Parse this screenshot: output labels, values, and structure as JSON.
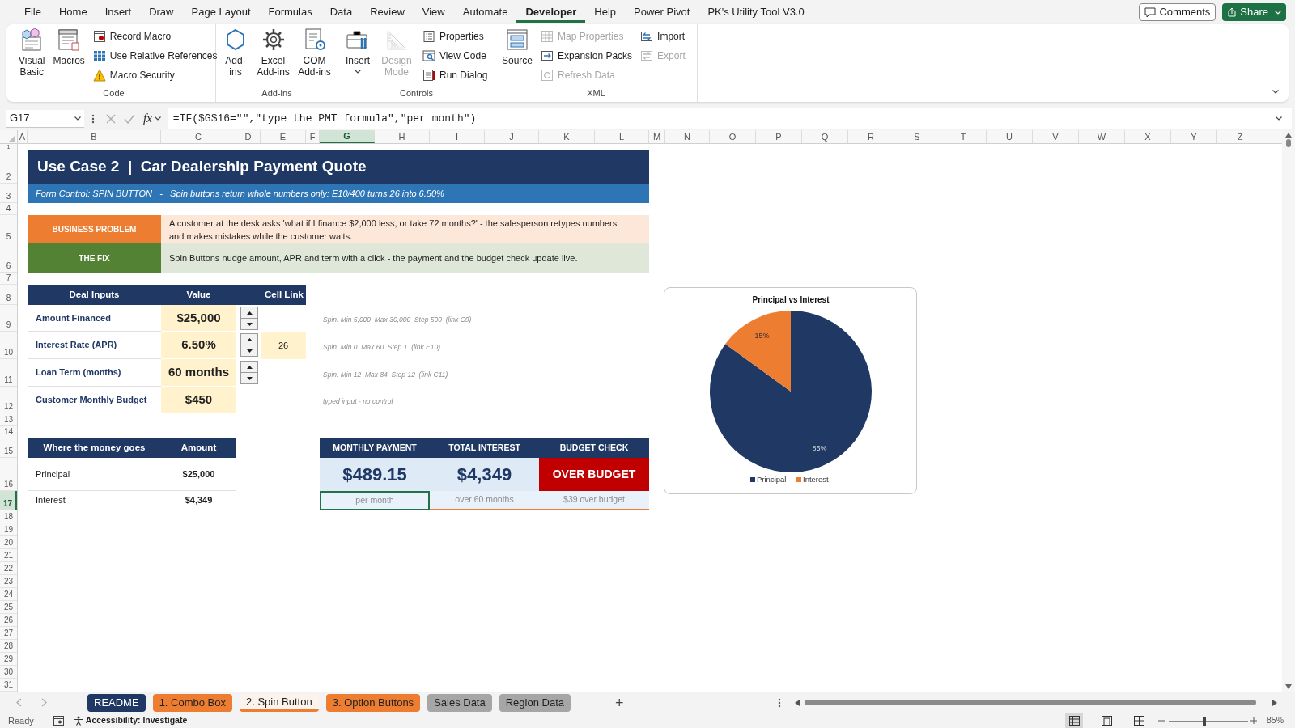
{
  "menu_tabs": [
    {
      "label": "File",
      "selected": false
    },
    {
      "label": "Home",
      "selected": false
    },
    {
      "label": "Insert",
      "selected": false
    },
    {
      "label": "Draw",
      "selected": false
    },
    {
      "label": "Page Layout",
      "selected": false
    },
    {
      "label": "Formulas",
      "selected": false
    },
    {
      "label": "Data",
      "selected": false
    },
    {
      "label": "Review",
      "selected": false
    },
    {
      "label": "View",
      "selected": false
    },
    {
      "label": "Automate",
      "selected": false
    },
    {
      "label": "Developer",
      "selected": true
    },
    {
      "label": "Help",
      "selected": false
    },
    {
      "label": "Power Pivot",
      "selected": false
    },
    {
      "label": "PK's Utility Tool V3.0",
      "selected": false
    }
  ],
  "header_buttons": [
    {
      "label": "Comments",
      "kind": "outline"
    },
    {
      "label": "Share",
      "kind": "primary"
    }
  ],
  "ribbon": {
    "groups": [
      {
        "label": "Code",
        "items": [
          {
            "label": "Visual Basic",
            "kind": "large",
            "disabled": false
          },
          {
            "label": "Macros",
            "kind": "large",
            "disabled": false
          },
          {
            "label": "Record Macro",
            "kind": "small",
            "disabled": false
          },
          {
            "label": "Use Relative References",
            "kind": "small",
            "disabled": false
          },
          {
            "label": "Macro Security",
            "kind": "small",
            "disabled": false
          }
        ]
      },
      {
        "label": "Add-ins",
        "items": [
          {
            "label": "Add-ins",
            "kind": "large",
            "disabled": false
          },
          {
            "label": "Excel Add-ins",
            "kind": "large",
            "disabled": false
          },
          {
            "label": "COM Add-ins",
            "kind": "large",
            "disabled": false
          }
        ]
      },
      {
        "label": "Controls",
        "items": [
          {
            "label": "Insert",
            "kind": "dropdown",
            "disabled": false
          },
          {
            "label": "Design Mode",
            "kind": "large",
            "disabled": true
          },
          {
            "label": "Properties",
            "kind": "small",
            "disabled": false
          },
          {
            "label": "View Code",
            "kind": "small",
            "disabled": false
          },
          {
            "label": "Run Dialog",
            "kind": "small",
            "disabled": false
          }
        ]
      },
      {
        "label": "XML",
        "items": [
          {
            "label": "Source",
            "kind": "large",
            "disabled": false
          },
          {
            "label": "Map Properties",
            "kind": "small",
            "disabled": true
          },
          {
            "label": "Expansion Packs",
            "kind": "small",
            "disabled": false
          },
          {
            "label": "Refresh Data",
            "kind": "small",
            "disabled": true
          },
          {
            "label": "Import",
            "kind": "small",
            "disabled": false
          },
          {
            "label": "Export",
            "kind": "small",
            "disabled": true
          }
        ]
      }
    ]
  },
  "formula_bar": {
    "name_box": "G17",
    "function_label": "fx",
    "formula": "=IF($G$16=\"\",\"type the PMT formula\",\"per month\")"
  },
  "columns": [
    {
      "label": "A",
      "selected": false
    },
    {
      "label": "B",
      "selected": false
    },
    {
      "label": "C",
      "selected": false
    },
    {
      "label": "D",
      "selected": false
    },
    {
      "label": "E",
      "selected": false
    },
    {
      "label": "F",
      "selected": false
    },
    {
      "label": "G",
      "selected": true
    },
    {
      "label": "H",
      "selected": false
    },
    {
      "label": "I",
      "selected": false
    },
    {
      "label": "J",
      "selected": false
    },
    {
      "label": "K",
      "selected": false
    },
    {
      "label": "L",
      "selected": false
    },
    {
      "label": "M",
      "selected": false
    },
    {
      "label": "N",
      "selected": false
    },
    {
      "label": "O",
      "selected": false
    },
    {
      "label": "P",
      "selected": false
    },
    {
      "label": "Q",
      "selected": false
    },
    {
      "label": "R",
      "selected": false
    },
    {
      "label": "S",
      "selected": false
    },
    {
      "label": "T",
      "selected": false
    },
    {
      "label": "U",
      "selected": false
    },
    {
      "label": "V",
      "selected": false
    },
    {
      "label": "W",
      "selected": false
    },
    {
      "label": "X",
      "selected": false
    },
    {
      "label": "Y",
      "selected": false
    },
    {
      "label": "Z",
      "selected": false
    }
  ],
  "rows": [
    {
      "label": "1",
      "selected": false
    },
    {
      "label": "2",
      "selected": false
    },
    {
      "label": "3",
      "selected": false
    },
    {
      "label": "4",
      "selected": false
    },
    {
      "label": "5",
      "selected": false
    },
    {
      "label": "6",
      "selected": false
    },
    {
      "label": "7",
      "selected": false
    },
    {
      "label": "8",
      "selected": false
    },
    {
      "label": "9",
      "selected": false
    },
    {
      "label": "10",
      "selected": false
    },
    {
      "label": "11",
      "selected": false
    },
    {
      "label": "12",
      "selected": false
    },
    {
      "label": "13",
      "selected": false
    },
    {
      "label": "14",
      "selected": false
    },
    {
      "label": "15",
      "selected": false
    },
    {
      "label": "16",
      "selected": false
    },
    {
      "label": "17",
      "selected": true
    },
    {
      "label": "18",
      "selected": false
    },
    {
      "label": "19",
      "selected": false
    },
    {
      "label": "20",
      "selected": false
    },
    {
      "label": "21",
      "selected": false
    },
    {
      "label": "22",
      "selected": false
    },
    {
      "label": "23",
      "selected": false
    },
    {
      "label": "24",
      "selected": false
    },
    {
      "label": "25",
      "selected": false
    },
    {
      "label": "26",
      "selected": false
    },
    {
      "label": "27",
      "selected": false
    },
    {
      "label": "28",
      "selected": false
    },
    {
      "label": "29",
      "selected": false
    },
    {
      "label": "30",
      "selected": false
    },
    {
      "label": "31",
      "selected": false
    }
  ],
  "title": "Use Case 2  |  Car Dealership Payment Quote",
  "subtitle": "Form Control: SPIN BUTTON   -   Spin buttons return whole numbers only: E10/400 turns 26 into 6.50%",
  "callouts": [
    {
      "label": "BUSINESS PROBLEM",
      "text": "A customer at the desk asks 'what if I finance $2,000 less, or take 72 months?' - the salesperson retypes numbers and makes mistakes while the customer waits.",
      "color": "#ed7d31"
    },
    {
      "label": "THE FIX",
      "text": "Spin Buttons nudge amount, APR and term with a click - the payment and the budget check update live.",
      "color": "#548235"
    }
  ],
  "deal_inputs": {
    "columns": [
      "Deal Inputs",
      "Value",
      "Cell Link"
    ],
    "rows": [
      {
        "label": "Amount Financed",
        "value": "$25,000",
        "spin": true,
        "note": "Spin: Min 5,000  Max 30,000  Step 500  (link C9)"
      },
      {
        "label": "Interest Rate (APR)",
        "value": "6.50%",
        "spin": true,
        "link": "26",
        "note": "Spin: Min 0  Max 60  Step 1  (link E10)"
      },
      {
        "label": "Loan Term (months)",
        "value": "60 months",
        "spin": true,
        "note": "Spin: Min 12  Max 84  Step 12  (link C11)"
      },
      {
        "label": "Customer Monthly Budget",
        "value": "$450",
        "spin": false,
        "note": "typed input - no control"
      }
    ]
  },
  "money": {
    "columns": [
      "Where the money goes",
      "Amount"
    ],
    "rows": [
      {
        "label": "Principal",
        "amount": "$25,000"
      },
      {
        "label": "Interest",
        "amount": "$4,349"
      }
    ]
  },
  "kpis": [
    {
      "label": "MONTHLY PAYMENT",
      "value": "$489.15",
      "note": "per month",
      "alert": false,
      "selected": true
    },
    {
      "label": "TOTAL INTEREST",
      "value": "$4,349",
      "note": "over 60 months",
      "alert": false,
      "selected": false
    },
    {
      "label": "BUDGET CHECK",
      "value": "OVER BUDGET",
      "note": "$39 over budget",
      "alert": true,
      "selected": false
    }
  ],
  "chart": {
    "chart_data": {
      "type": "pie",
      "title": "Principal vs Interest",
      "categories": [
        "Principal",
        "Interest"
      ],
      "values": [
        85,
        15
      ],
      "colors": [
        "#1f3864",
        "#ed7d31"
      ],
      "value_labels": [
        "85%",
        "15%"
      ],
      "legend": "bottom"
    }
  },
  "sheet_tabs": [
    {
      "label": "README",
      "color": "#1f3864",
      "selected": false
    },
    {
      "label": "1. Combo Box",
      "color": "#ed7d31",
      "selected": false
    },
    {
      "label": "2. Spin Button",
      "color": "#ed7d31",
      "selected": true
    },
    {
      "label": "3. Option Buttons",
      "color": "#ed7d31",
      "selected": false
    },
    {
      "label": "Sales Data",
      "color": "#a6a6a6",
      "selected": false
    },
    {
      "label": "Region Data",
      "color": "#a6a6a6",
      "selected": false
    }
  ],
  "add_sheet": "+",
  "status_bar": {
    "ready": "Ready",
    "accessibility": "Accessibility: Investigate",
    "view_modes": [
      {
        "selected": true
      },
      {
        "selected": false
      },
      {
        "selected": false
      }
    ],
    "zoom": {
      "level": 0.43,
      "reading": "85%"
    }
  }
}
